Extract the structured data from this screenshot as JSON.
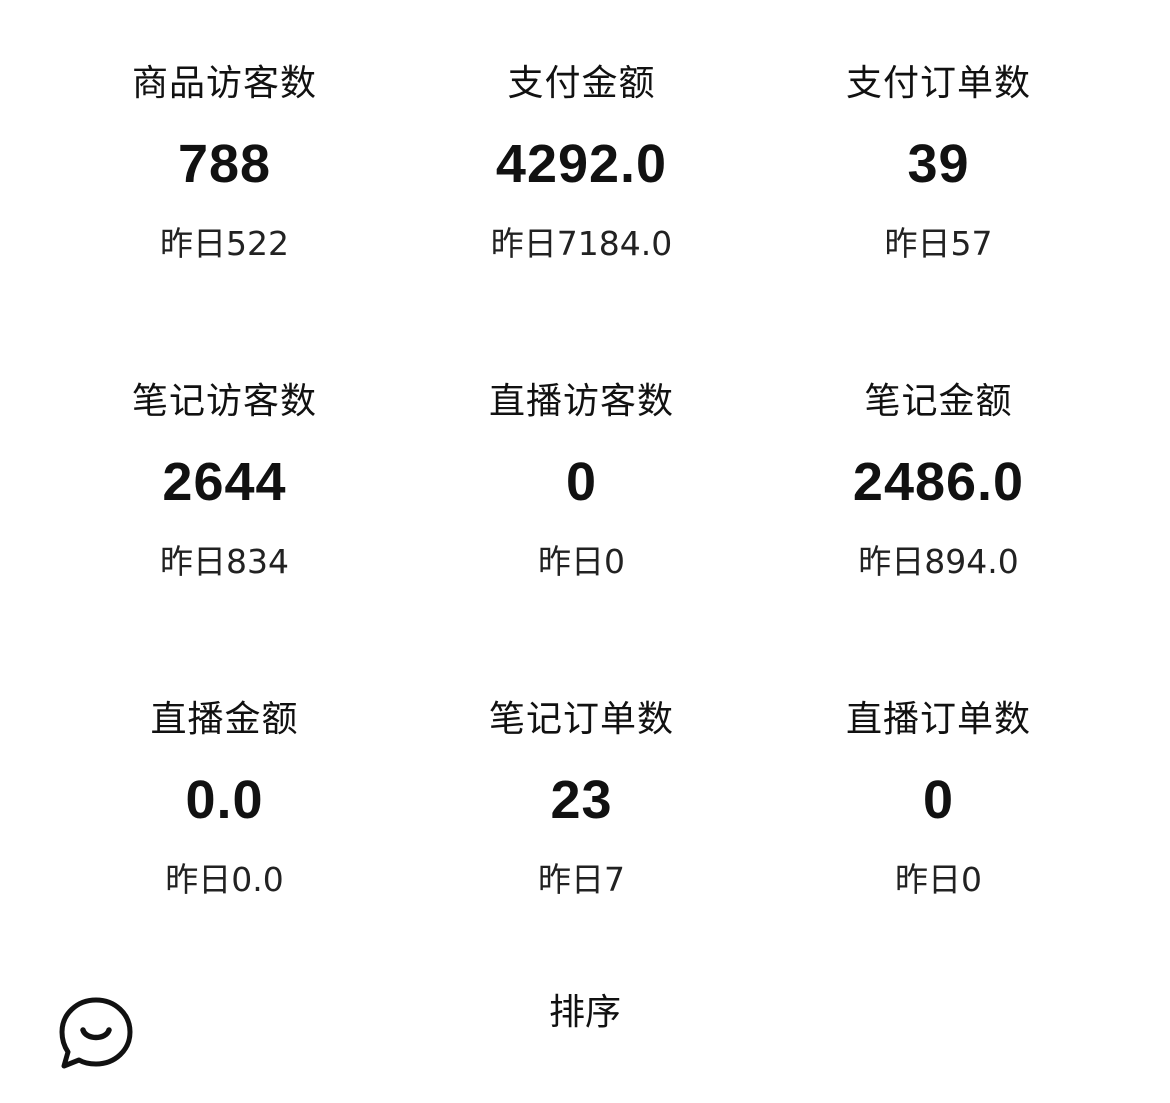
{
  "stats": [
    {
      "label": "商品访客数",
      "value": "788",
      "yesterday": "昨日522"
    },
    {
      "label": "支付金额",
      "value": "4292.0",
      "yesterday": "昨日7184.0"
    },
    {
      "label": "支付订单数",
      "value": "39",
      "yesterday": "昨日57"
    },
    {
      "label": "笔记访客数",
      "value": "2644",
      "yesterday": "昨日834"
    },
    {
      "label": "直播访客数",
      "value": "0",
      "yesterday": "昨日0"
    },
    {
      "label": "笔记金额",
      "value": "2486.0",
      "yesterday": "昨日894.0"
    },
    {
      "label": "直播金额",
      "value": "0.0",
      "yesterday": "昨日0.0"
    },
    {
      "label": "笔记订单数",
      "value": "23",
      "yesterday": "昨日7"
    },
    {
      "label": "直播订单数",
      "value": "0",
      "yesterday": "昨日0"
    }
  ],
  "sort_label": "排序",
  "chat_icon": "chat-bubble-smile-icon"
}
